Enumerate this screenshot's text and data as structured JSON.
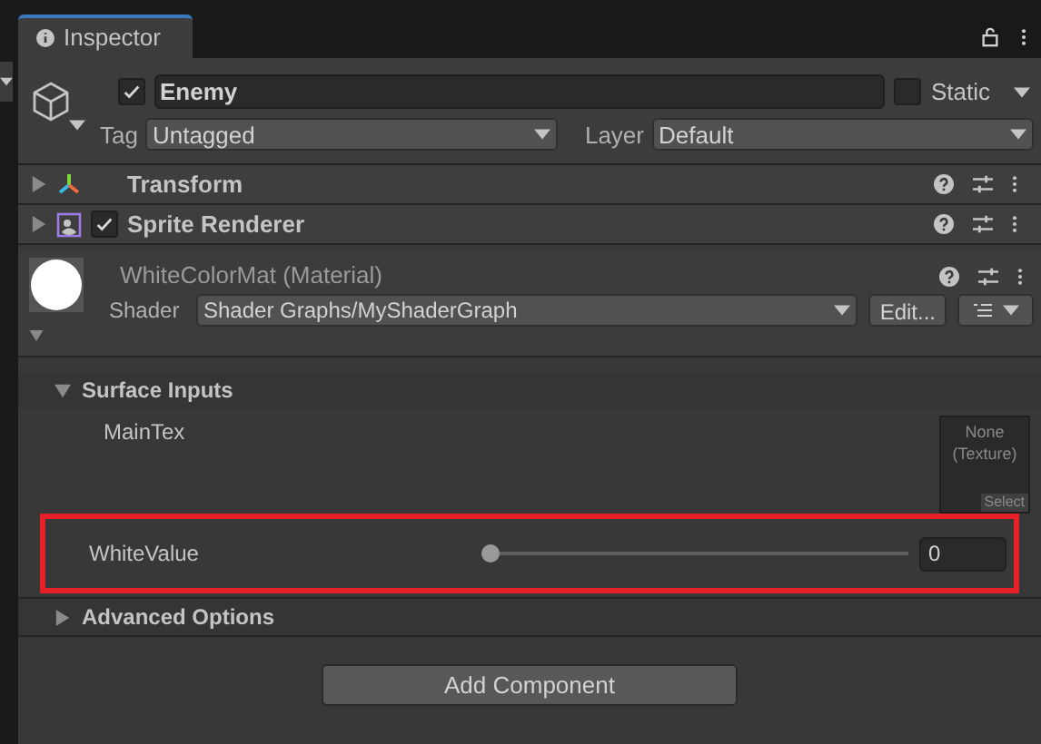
{
  "tab": {
    "title": "Inspector"
  },
  "object": {
    "active": true,
    "name": "Enemy",
    "static": false,
    "static_label": "Static",
    "tag_label": "Tag",
    "tag": "Untagged",
    "layer_label": "Layer",
    "layer": "Default"
  },
  "components": [
    {
      "kind": "transform",
      "name": "Transform"
    },
    {
      "kind": "sprite",
      "name": "Sprite Renderer",
      "enabled": true
    }
  ],
  "material": {
    "title": "WhiteColorMat (Material)",
    "shader_label": "Shader",
    "shader": "Shader Graphs/MyShaderGraph",
    "edit": "Edit..."
  },
  "sections": [
    {
      "title": "Surface Inputs",
      "expanded": true,
      "properties": [
        {
          "kind": "texture",
          "label": "MainTex",
          "value": "None (Texture)",
          "button": "Select"
        },
        {
          "kind": "slider",
          "label": "WhiteValue",
          "level": 0,
          "value": "0",
          "highlighted": true
        }
      ]
    },
    {
      "title": "Advanced Options",
      "expanded": false
    }
  ],
  "add_button": "Add Component"
}
